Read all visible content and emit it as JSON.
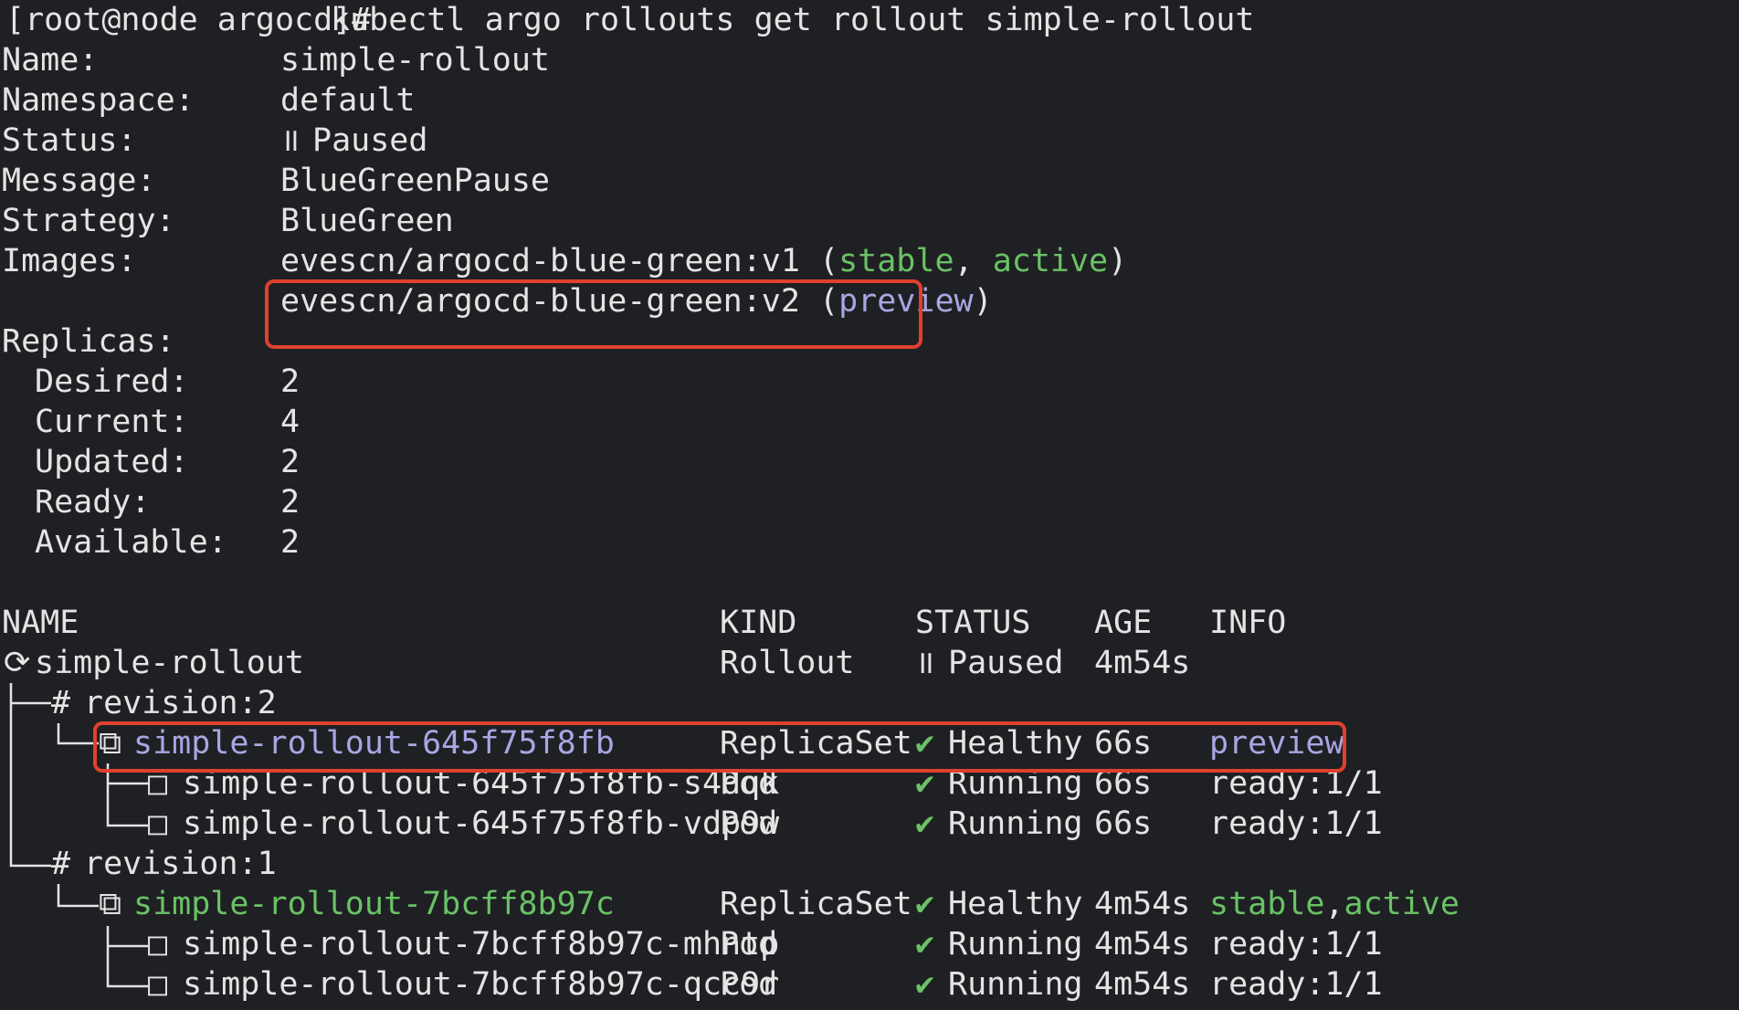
{
  "command": {
    "prompt": "[root@node argocd]# ",
    "text": "kubectl argo rollouts get rollout simple-rollout"
  },
  "summary": {
    "name_label": "Name:",
    "name_value": "simple-rollout",
    "namespace_label": "Namespace:",
    "namespace_value": "default",
    "status_label": "Status:",
    "status_icon": "॥",
    "status_value": "Paused",
    "message_label": "Message:",
    "message_value": "BlueGreenPause",
    "strategy_label": "Strategy:",
    "strategy_value": "BlueGreen",
    "images_label": "Images:",
    "images": [
      {
        "image": "evescn/argocd-blue-green:v1 (",
        "tag1": "stable",
        "sep": ", ",
        "tag2": "active",
        "close": ")"
      },
      {
        "image": "evescn/argocd-blue-green:v2 (",
        "tag1": "preview",
        "close": ")"
      }
    ]
  },
  "replicas": {
    "label": "Replicas:",
    "desired_label": "Desired:",
    "desired": "2",
    "current_label": "Current:",
    "current": "4",
    "updated_label": "Updated:",
    "updated": "2",
    "ready_label": "Ready:",
    "ready": "2",
    "available_label": "Available:",
    "available": "2"
  },
  "table": {
    "headers": {
      "name": "NAME",
      "kind": "KIND",
      "status": "STATUS",
      "age": "AGE",
      "info": "INFO"
    },
    "rows": [
      {
        "tree": "⟳ ",
        "name": "simple-rollout",
        "kind": "Rollout",
        "status_icon": "॥",
        "status": "Paused",
        "age": "4m54s",
        "info": ""
      },
      {
        "tree": "# ",
        "name": "revision:2",
        "kind": "",
        "status_icon": "",
        "status": "",
        "age": "",
        "info": ""
      },
      {
        "tree": "⧉ ",
        "name": "simple-rollout-645f75f8fb",
        "kind": "ReplicaSet",
        "status_icon": "✔",
        "status": "Healthy",
        "age": "66s",
        "info": "preview"
      },
      {
        "tree": "□ ",
        "name": "simple-rollout-645f75f8fb-s4dqk",
        "kind": "Pod",
        "status_icon": "✔",
        "status": "Running",
        "age": "66s",
        "info": "ready:1/1"
      },
      {
        "tree": "□ ",
        "name": "simple-rollout-645f75f8fb-vdp9w",
        "kind": "Pod",
        "status_icon": "✔",
        "status": "Running",
        "age": "66s",
        "info": "ready:1/1"
      },
      {
        "tree": "# ",
        "name": "revision:1",
        "kind": "",
        "status_icon": "",
        "status": "",
        "age": "",
        "info": ""
      },
      {
        "tree": "⧉ ",
        "name": "simple-rollout-7bcff8b97c",
        "kind": "ReplicaSet",
        "status_icon": "✔",
        "status": "Healthy",
        "age": "4m54s",
        "info_tag1": "stable",
        "info_sep": ",",
        "info_tag2": "active"
      },
      {
        "tree": "□ ",
        "name": "simple-rollout-7bcff8b97c-mhntp",
        "kind": "Pod",
        "status_icon": "✔",
        "status": "Running",
        "age": "4m54s",
        "info": "ready:1/1"
      },
      {
        "tree": "□ ",
        "name": "simple-rollout-7bcff8b97c-qcc9r",
        "kind": "Pod",
        "status_icon": "✔",
        "status": "Running",
        "age": "4m54s",
        "info": "ready:1/1"
      }
    ]
  },
  "colors": {
    "background": "#1f2023",
    "text": "#e4e4e4",
    "green": "#6ac266",
    "purple": "#a8a6e3",
    "highlight_box": "#e0402e"
  }
}
